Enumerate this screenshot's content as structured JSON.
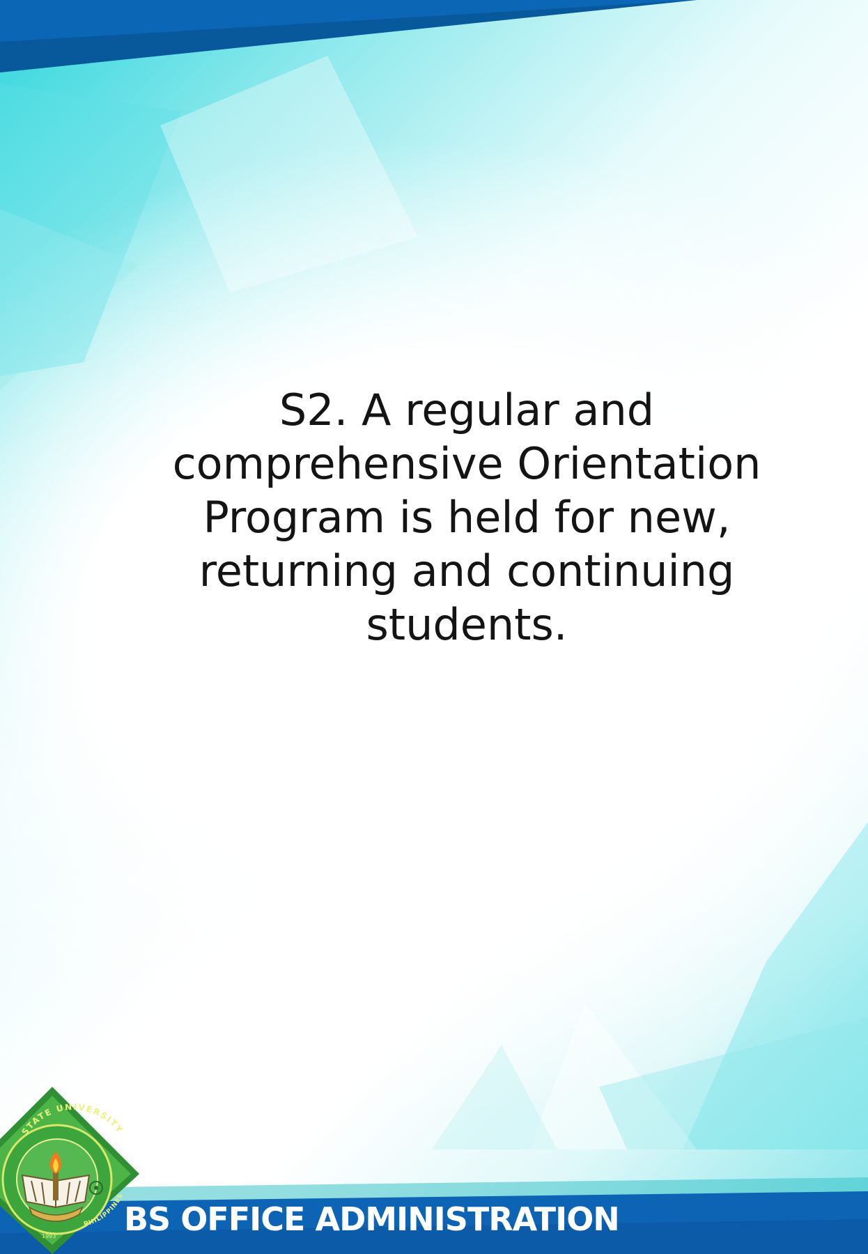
{
  "slide": {
    "statement": "S2. A regular and comprehensive Orientation Program is held for new, returning and continuing students."
  },
  "footer": {
    "program_title": "BS OFFICE ADMINISTRATION"
  },
  "logo": {
    "seal_text_top": "STATE UNIVERSITY",
    "seal_text_bottom": "PHILIPPINES",
    "seal_year": "1993"
  },
  "colors": {
    "top_band": "#0a5fa8",
    "bottom_band": "#0d63b4",
    "accent_cyan": "#34d8de",
    "logo_green": "#3ca63c",
    "text": "#141414"
  }
}
